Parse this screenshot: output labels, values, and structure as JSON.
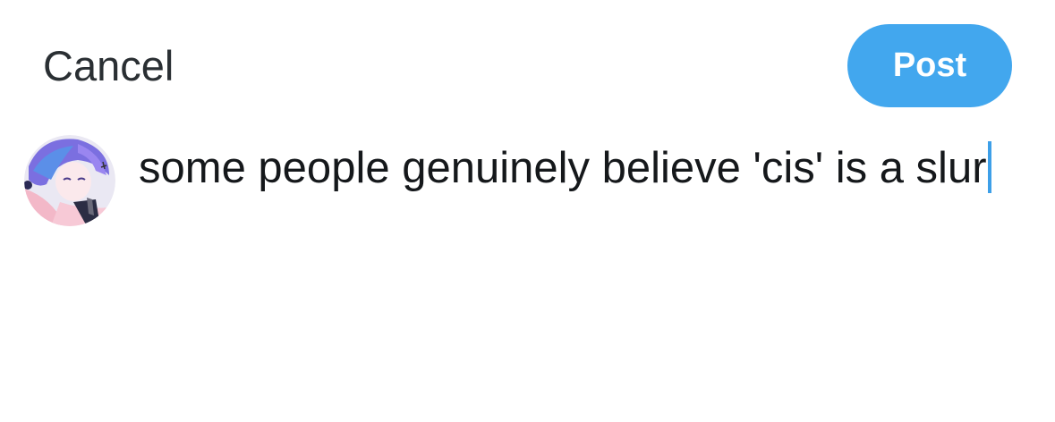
{
  "header": {
    "cancel_label": "Cancel",
    "post_label": "Post"
  },
  "composer": {
    "text": "some people genuinely believe 'cis' is a slur",
    "caret_color": "#3d9fe8"
  },
  "colors": {
    "accent": "#42a7ee",
    "text": "#15181b",
    "cancel_text": "#2a2f33"
  },
  "avatar": {
    "icon": "user-avatar-icon"
  }
}
